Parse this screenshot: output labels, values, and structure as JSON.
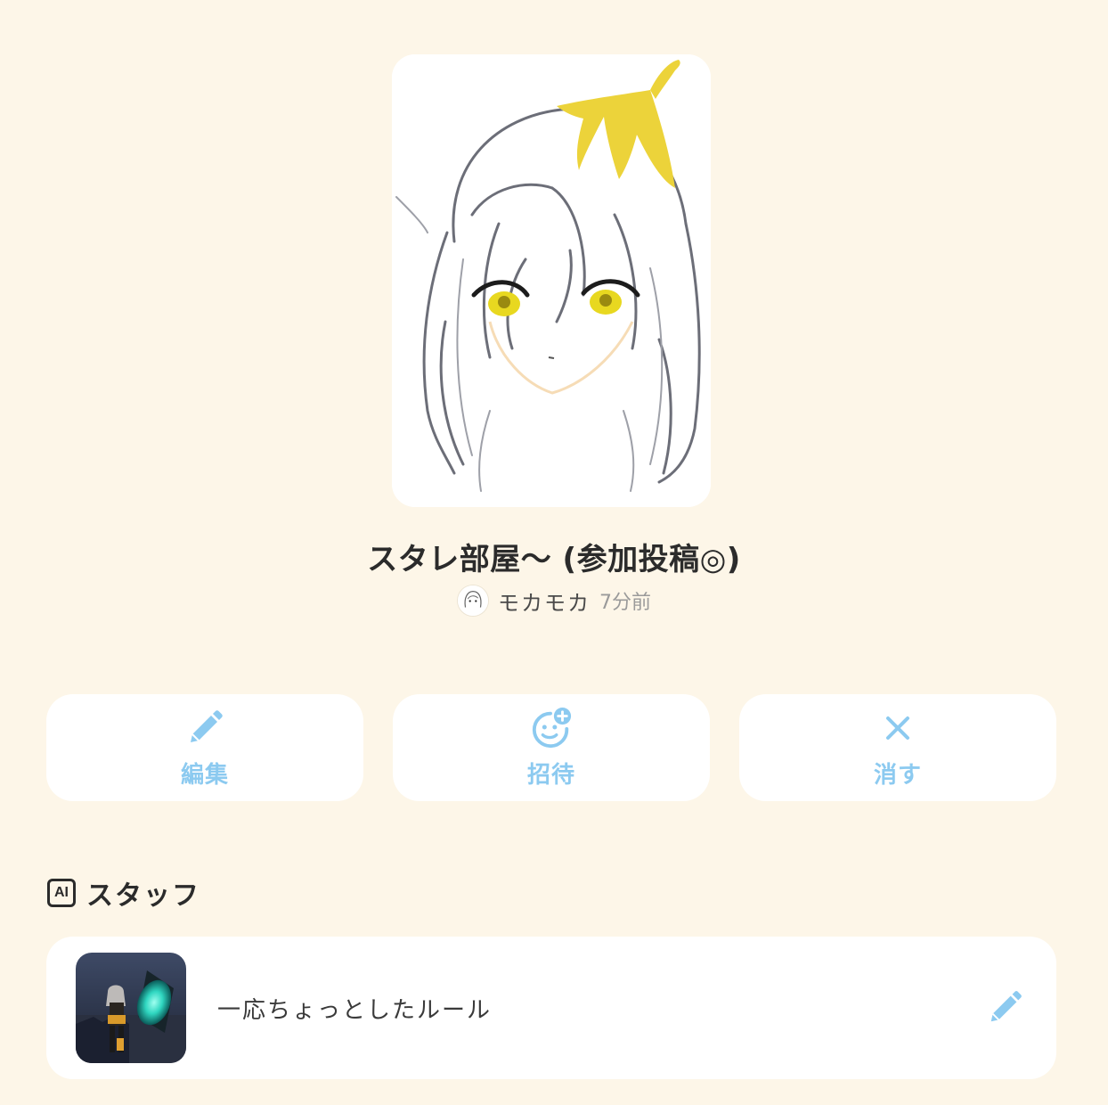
{
  "room": {
    "title": "スタレ部屋〜 (参加投稿◎)",
    "author": "モカモカ",
    "posted": "7分前"
  },
  "actions": {
    "edit_label": "編集",
    "invite_label": "招待",
    "delete_label": "消す"
  },
  "staff_section": {
    "badge": "AI",
    "title": "スタッフ",
    "items": [
      {
        "name": "一応ちょっとしたルール"
      }
    ]
  },
  "colors": {
    "background": "#fdf6e8",
    "card": "#ffffff",
    "accent": "#8ccaf0",
    "text": "#2b2b2b",
    "muted": "#9a9a9a"
  },
  "icons": {
    "edit": "pencil-icon",
    "invite": "add-friend-icon",
    "delete": "close-icon",
    "staff_edit": "pencil-icon"
  }
}
